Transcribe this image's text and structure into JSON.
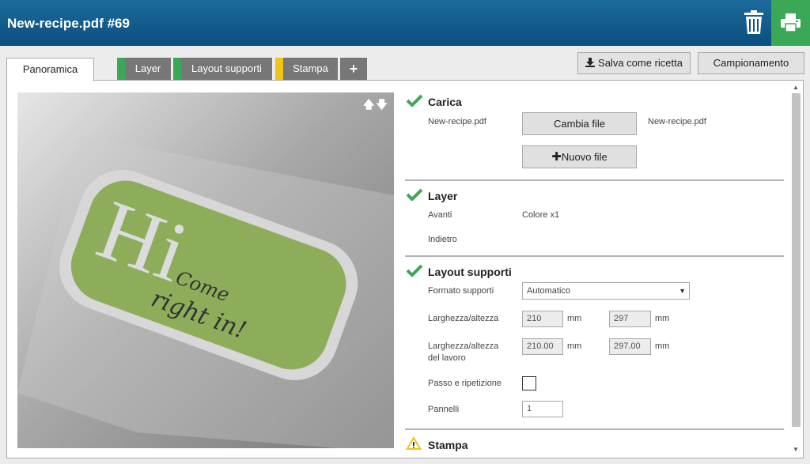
{
  "app": {
    "title": "New-recipe.pdf #69",
    "icons": {
      "trash": "trash-icon",
      "print": "printer-icon"
    },
    "colors": {
      "header": "#0b4f7f",
      "print": "#3aa856",
      "ok": "#3aa856",
      "warn": "#f0c419"
    }
  },
  "tabs": [
    {
      "label": "Panoramica"
    },
    {
      "label": "Layer",
      "stripe": "#3aa856"
    },
    {
      "label": "Layout supporti",
      "stripe": "#3aa856"
    },
    {
      "label": "Stampa",
      "stripe": "#f0c419"
    },
    {
      "label": "+"
    }
  ],
  "toolbar": {
    "save_recipe": "Salva come ricetta",
    "sampling": "Campionamento"
  },
  "preview": {
    "arrows": "🡅🡇",
    "artwork": {
      "big": "Hi",
      "line1": "Come",
      "line2": "right in!"
    }
  },
  "carica": {
    "title": "Carica",
    "file_label": "New-recipe.pdf",
    "change_button": "Cambia file",
    "file_value": "New-recipe.pdf",
    "new_button": "Nuovo file"
  },
  "layer": {
    "title": "Layer",
    "front_label": "Avanti",
    "front_value": "Colore x1",
    "back_label": "Indietro"
  },
  "layout": {
    "title": "Layout supporti",
    "media_format_label": "Formato supporti",
    "media_format_value": "Automatico",
    "size_label": "Larghezza/altezza",
    "width": "210",
    "height": "297",
    "unit": "mm",
    "job_size_label_1": "Larghezza/altezza",
    "job_size_label_2": "del lavoro",
    "job_width": "210.00",
    "job_height": "297.00",
    "step_repeat_label": "Passo e ripetizione",
    "panels_label": "Pannelli",
    "panels_value": "1"
  },
  "stampa": {
    "title": "Stampa"
  }
}
